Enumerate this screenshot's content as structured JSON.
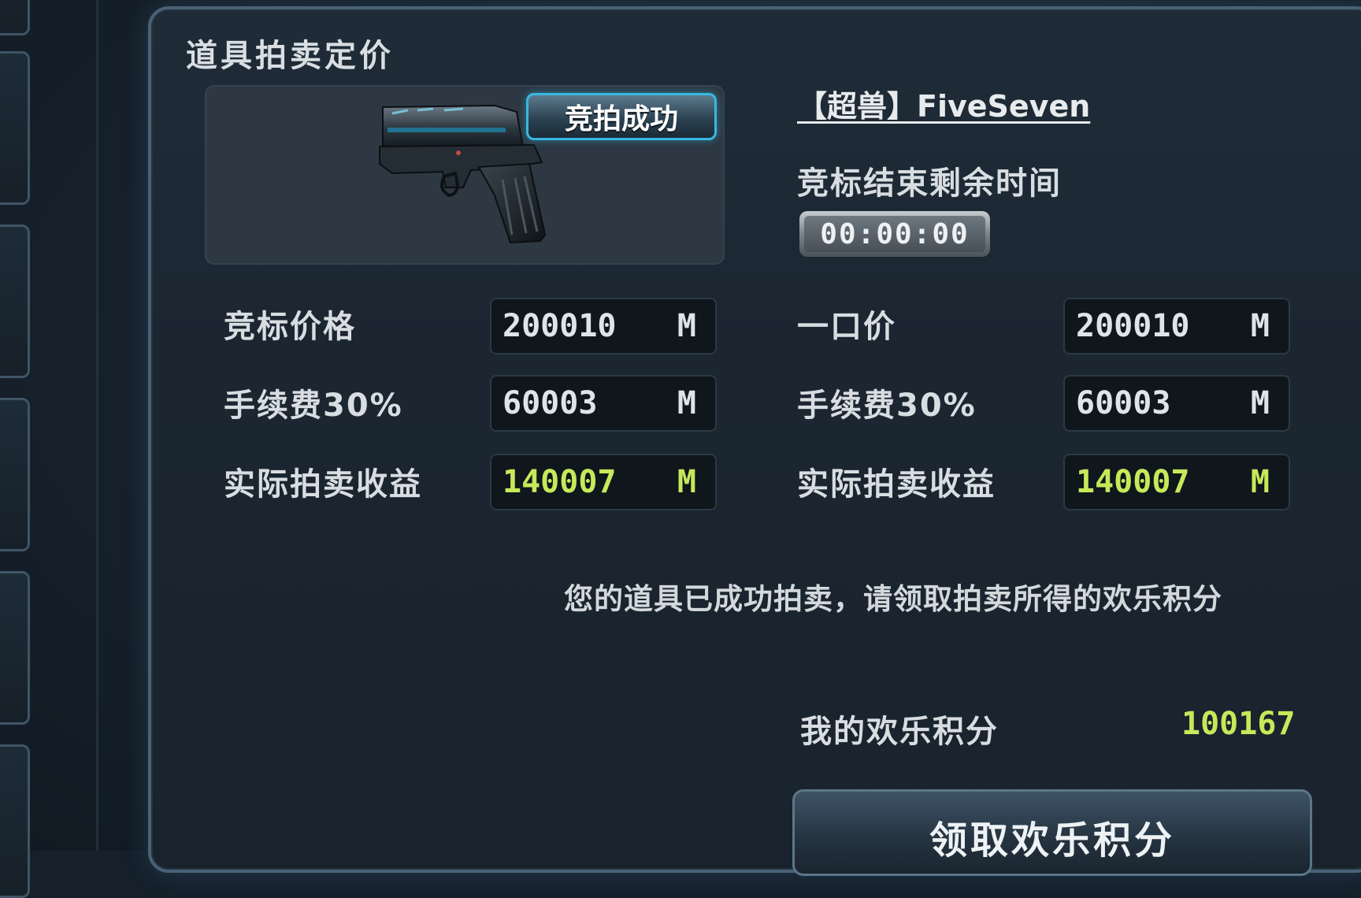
{
  "panel": {
    "title": "道具拍卖定价"
  },
  "item": {
    "name": "【超兽】FiveSeven",
    "status_badge": "竞拍成功",
    "icon": "pistol-icon"
  },
  "timer": {
    "label": "竞标结束剩余时间",
    "value": "00:00:00"
  },
  "auction": {
    "price_label": "竞标价格",
    "price_value": "200010",
    "fee_label": "手续费30%",
    "fee_value": "60003",
    "income_label": "实际拍卖收益",
    "income_value": "140007",
    "unit": "M"
  },
  "buyout": {
    "price_label": "一口价",
    "price_value": "200010",
    "fee_label": "手续费30%",
    "fee_value": "60003",
    "income_label": "实际拍卖收益",
    "income_value": "140007",
    "unit": "M"
  },
  "message": "您的道具已成功拍卖，请领取拍卖所得的欢乐积分",
  "score": {
    "label": "我的欢乐积分",
    "value": "100167"
  },
  "claim_button": "领取欢乐积分",
  "colors": {
    "accent_green": "#c6e95a",
    "badge_border": "#38b8e0"
  }
}
